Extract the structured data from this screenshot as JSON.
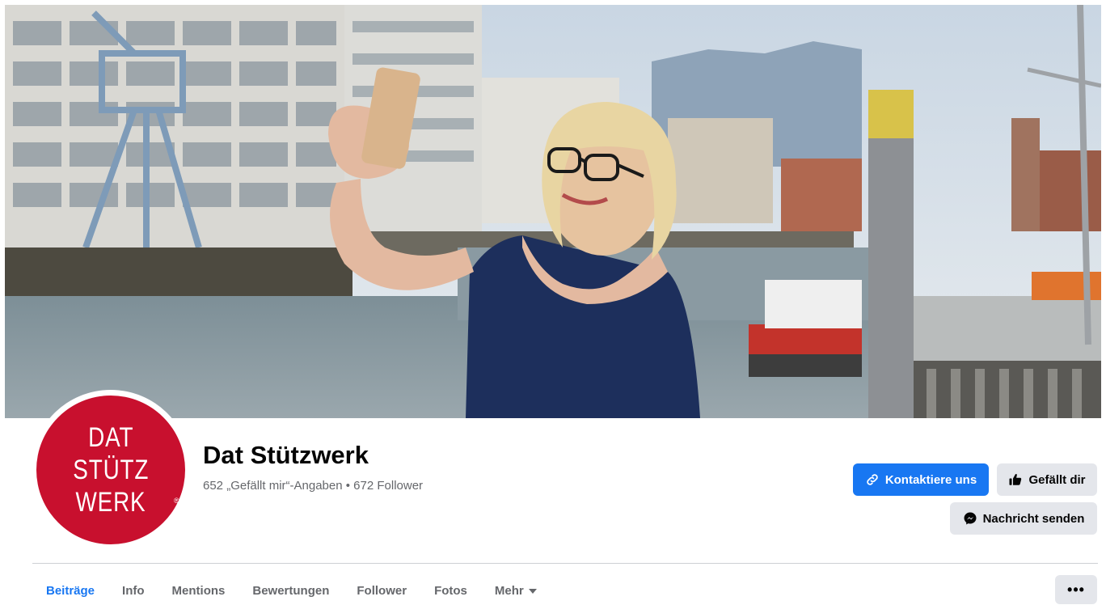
{
  "page": {
    "name": "Dat Stützwerk",
    "stats": "652 „Gefällt mir“-Angaben • 672 Follower"
  },
  "logo": {
    "lines": [
      "DAT",
      "STÜTZ",
      "WERK"
    ],
    "mark": "®",
    "background": "#c8102e"
  },
  "actions": {
    "contact_label": "Kontaktiere uns",
    "like_label": "Gefällt dir",
    "message_label": "Nachricht senden",
    "more_label": "•••"
  },
  "nav": {
    "items": [
      {
        "label": "Beiträge",
        "active": true
      },
      {
        "label": "Info"
      },
      {
        "label": "Mentions"
      },
      {
        "label": "Bewertungen"
      },
      {
        "label": "Follower"
      },
      {
        "label": "Fotos"
      },
      {
        "label": "Mehr",
        "has_dropdown": true
      }
    ]
  },
  "colors": {
    "accent": "#1877f2",
    "secondary_button": "#e4e6eb",
    "muted_text": "#65676b"
  },
  "icons": {
    "contact": "link-icon",
    "like": "thumbs-up-icon",
    "message": "messenger-icon",
    "dropdown": "caret-down-icon",
    "more": "ellipsis-icon"
  }
}
